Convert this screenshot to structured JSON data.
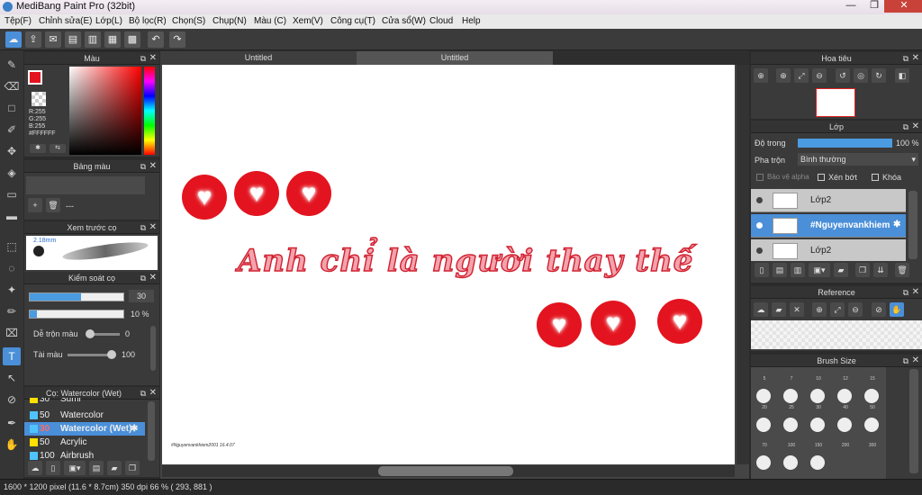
{
  "window": {
    "title": "MediBang Paint Pro (32bit)"
  },
  "menu": [
    "Tệp(F)",
    "Chỉnh sửa(E)",
    "Lớp(L)",
    "Bộ lọc(R)",
    "Chọn(S)",
    "Chụp(N)",
    "Màu (C)",
    "Xem(V)",
    "Công cụ(T)",
    "Cửa sổ(W)",
    "Cloud",
    "Help"
  ],
  "tabs": [
    "Untitled",
    "Untitled"
  ],
  "color_panel": {
    "title": "Màu",
    "r": "R:255",
    "g": "G:255",
    "b": "B:255",
    "hex": "#FFFFFF",
    "accent": "#e3141f"
  },
  "palette_panel": {
    "title": "Bảng màu",
    "empty": "---"
  },
  "brush_preview": {
    "title": "Xem trước cọ",
    "size": "2.18mm"
  },
  "brush_control": {
    "title": "Kiểm soát cọ",
    "size_value": "30",
    "opacity_value": "10 %",
    "blend_label": "Dễ trộn màu",
    "blend_value": "0",
    "density_label": "Tài màu",
    "density_value": "100"
  },
  "brush_list": {
    "title": "Cọ: Watercolor (Wet)",
    "items": [
      {
        "size": "30",
        "name": "Sumi",
        "color": "#ffe000"
      },
      {
        "size": "50",
        "name": "Watercolor",
        "color": "#4fc3ff"
      },
      {
        "size": "30",
        "name": "Watercolor (Wet)",
        "color": "#4fc3ff",
        "selected": true
      },
      {
        "size": "50",
        "name": "Acrylic",
        "color": "#ffe000"
      },
      {
        "size": "100",
        "name": "Airbrush",
        "color": "#4fc3ff"
      }
    ]
  },
  "canvas": {
    "text": "Anh chỉ là người thay thế",
    "signature": "#Nguyenvankhiem2001 16.4.07",
    "bg": "#ffffff"
  },
  "navigator": {
    "title": "Hoa tiêu"
  },
  "layer_panel": {
    "title": "Lớp",
    "opacity_label": "Độ trong",
    "opacity_value": "100 %",
    "opacity_fraction": 1.0,
    "blend_label": "Pha trộn",
    "blend_value": "Bình thường",
    "protect_alpha": "Bảo vệ alpha",
    "clipping": "Xén bớt",
    "lock": "Khóa",
    "layers": [
      {
        "name": "Lớp2"
      },
      {
        "name": "#Nguyenvankhiem",
        "selected": true
      },
      {
        "name": "Lớp2"
      }
    ]
  },
  "reference": {
    "title": "Reference"
  },
  "brush_size": {
    "title": "Brush Size",
    "rows": [
      [
        "5",
        "7",
        "10",
        "12",
        "15"
      ],
      [
        "20",
        "25",
        "30",
        "40",
        "50"
      ],
      [
        "70",
        "100",
        "150",
        "200",
        "300"
      ]
    ]
  },
  "status": {
    "text": "1600 * 1200 pixel  (11.6 * 8.7cm)  350 dpi  66 %  ( 293, 881 )"
  }
}
